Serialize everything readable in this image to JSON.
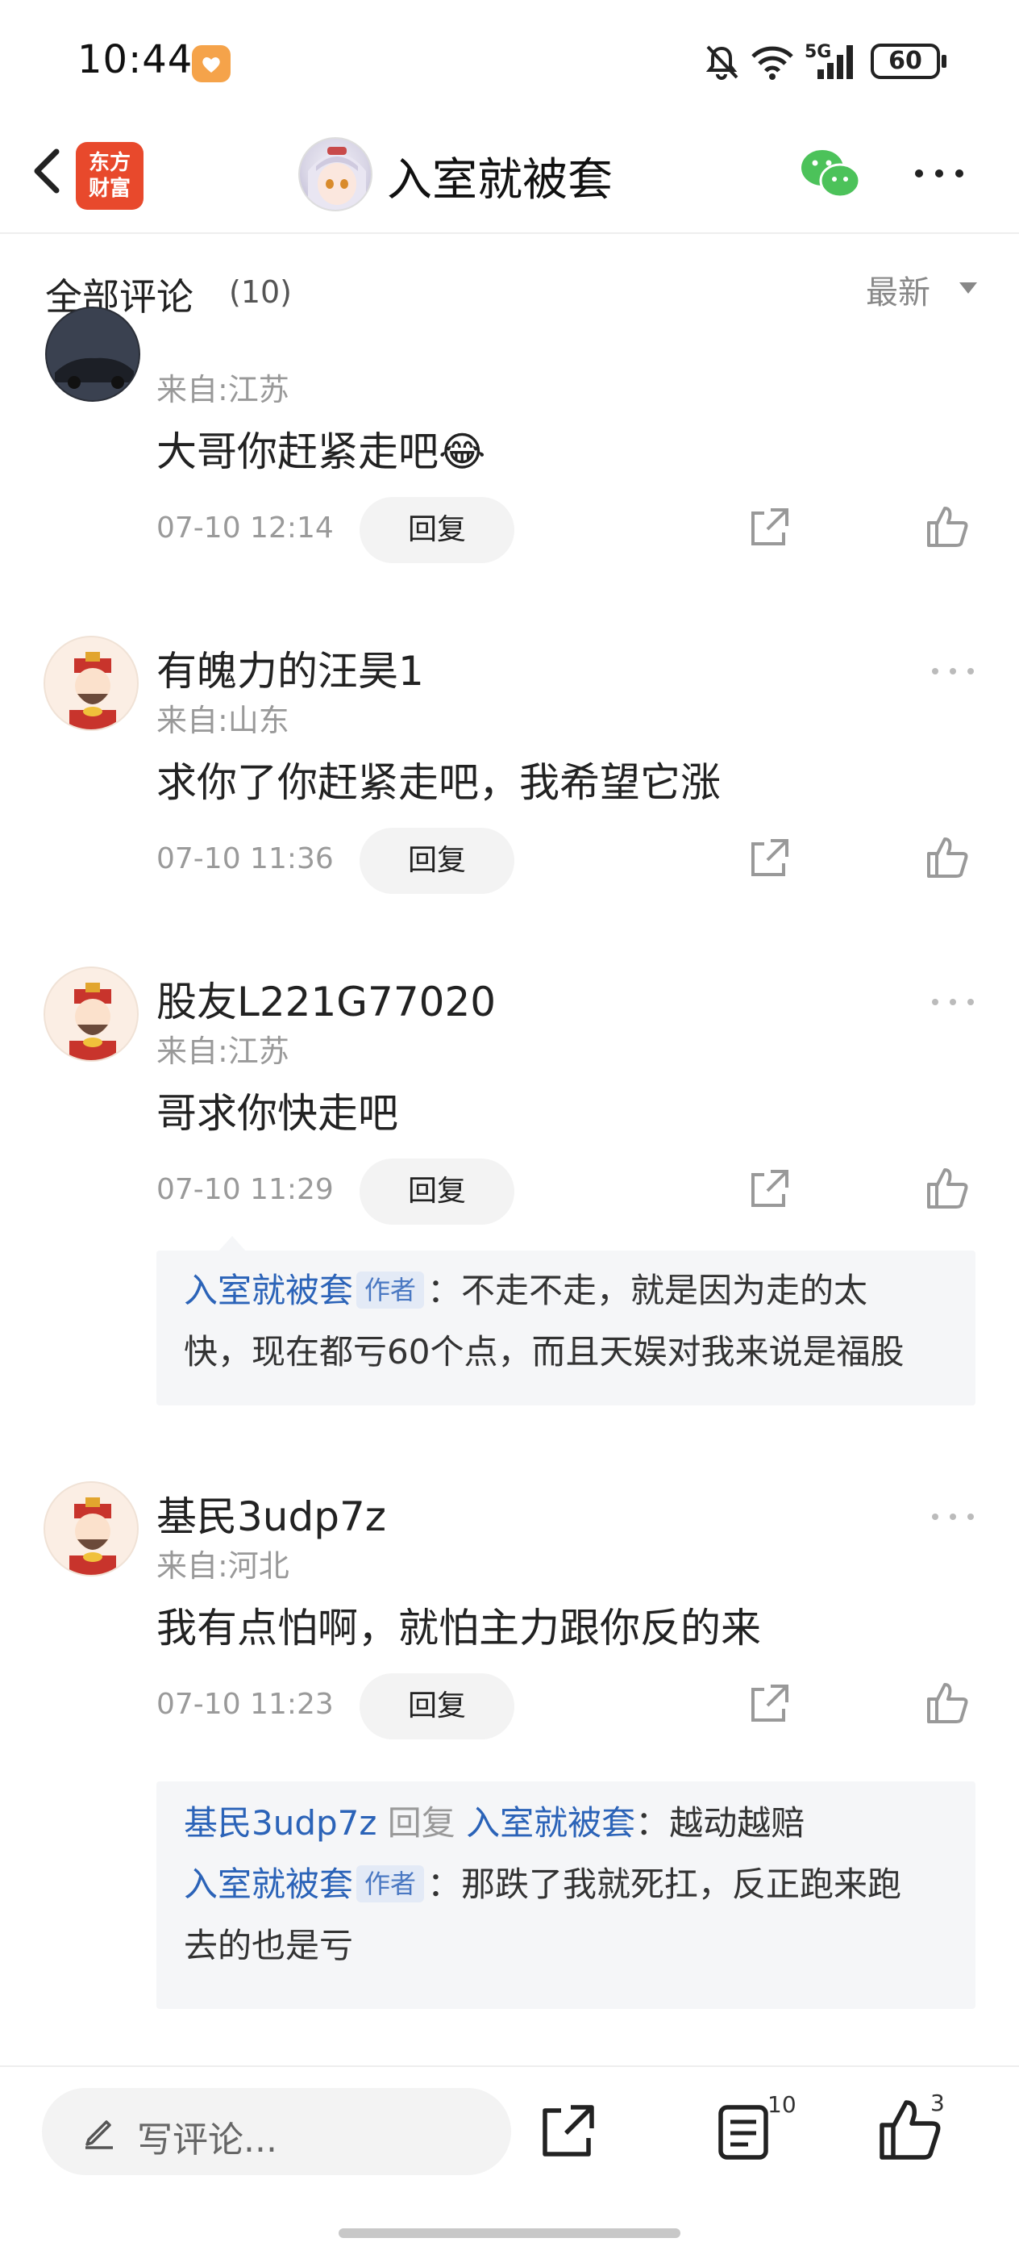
{
  "status_bar": {
    "time": "10:44",
    "network": "5G",
    "battery": "60"
  },
  "header": {
    "app_logo_line1": "东方",
    "app_logo_line2": "财富",
    "title": "入室就被套"
  },
  "section": {
    "title": "全部评论",
    "count": "(10)",
    "sort": "最新"
  },
  "comments": [
    {
      "username": "",
      "location": "来自:江苏",
      "text": "大哥你赶紧走吧😂",
      "time": "07-10 12:14",
      "reply_label": "回复"
    },
    {
      "username": "有魄力的汪昊1",
      "location": "来自:山东",
      "text": "求你了你赶紧走吧，我希望它涨",
      "time": "07-10 11:36",
      "reply_label": "回复"
    },
    {
      "username": "股友L221G77020",
      "location": "来自:江苏",
      "text": "哥求你快走吧",
      "time": "07-10 11:29",
      "reply_label": "回复",
      "replies": [
        {
          "author": "入室就被套",
          "tag": "作者",
          "line1": "：不走不走，就是因为走的太",
          "line2": "快，现在都亏60个点，而且天娱对我来说是福股"
        }
      ]
    },
    {
      "username": "基民3udp7z",
      "location": "来自:河北",
      "text": "我有点怕啊，就怕主力跟你反的来",
      "time": "07-10 11:23",
      "reply_label": "回复",
      "replies": [
        {
          "from": "基民3udp7z",
          "verb": "回复",
          "to": "入室就被套",
          "text": "：越动越赔"
        },
        {
          "author": "入室就被套",
          "tag": "作者",
          "line1": "：那跌了我就死扛，反正跑来跑",
          "line2": "去的也是亏"
        }
      ]
    }
  ],
  "bottom_bar": {
    "placeholder": "写评论...",
    "comment_count": "10",
    "like_count": "3"
  }
}
